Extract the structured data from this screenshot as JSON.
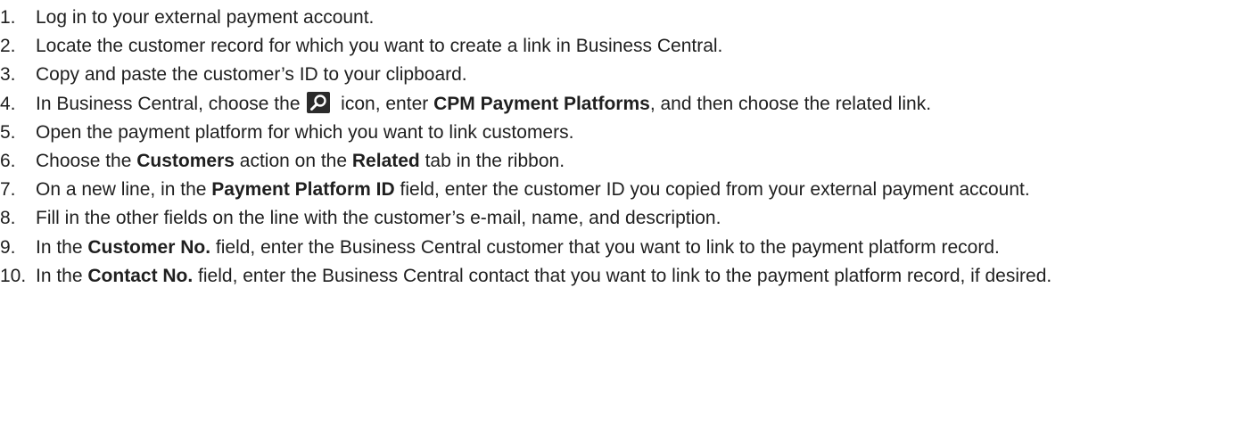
{
  "steps": [
    {
      "num": "1.",
      "parts": [
        {
          "t": "text",
          "v": "Log in to your external payment account."
        }
      ]
    },
    {
      "num": "2.",
      "parts": [
        {
          "t": "text",
          "v": "Locate the customer record for which you want to create a link in Business Central."
        }
      ]
    },
    {
      "num": "3.",
      "parts": [
        {
          "t": "text",
          "v": "Copy and paste the customer’s ID to your clipboard."
        }
      ]
    },
    {
      "num": "4.",
      "parts": [
        {
          "t": "text",
          "v": "In Business Central, choose the "
        },
        {
          "t": "icon",
          "v": "search-icon"
        },
        {
          "t": "text",
          "v": " icon, enter "
        },
        {
          "t": "bold",
          "v": "CPM Payment Platforms"
        },
        {
          "t": "text",
          "v": ", and then choose the related link."
        }
      ]
    },
    {
      "num": "5.",
      "parts": [
        {
          "t": "text",
          "v": "Open the payment platform for which you want to link customers."
        }
      ]
    },
    {
      "num": "6.",
      "parts": [
        {
          "t": "text",
          "v": "Choose the "
        },
        {
          "t": "bold",
          "v": "Customers"
        },
        {
          "t": "text",
          "v": " action on the "
        },
        {
          "t": "bold",
          "v": "Related"
        },
        {
          "t": "text",
          "v": " tab in the ribbon."
        }
      ]
    },
    {
      "num": "7.",
      "parts": [
        {
          "t": "text",
          "v": "On a new line, in the "
        },
        {
          "t": "bold",
          "v": "Payment Platform ID"
        },
        {
          "t": "text",
          "v": " field, enter the customer ID you copied from your external payment account."
        }
      ]
    },
    {
      "num": "8.",
      "parts": [
        {
          "t": "text",
          "v": "Fill in the other fields on the line with the customer’s e-mail, name, and description."
        }
      ]
    },
    {
      "num": "9.",
      "parts": [
        {
          "t": "text",
          "v": "In the "
        },
        {
          "t": "bold",
          "v": "Customer No."
        },
        {
          "t": "text",
          "v": " field, enter the Business Central customer that you want to link to the payment platform record."
        }
      ]
    },
    {
      "num": "10.",
      "parts": [
        {
          "t": "text",
          "v": "In the "
        },
        {
          "t": "bold",
          "v": "Contact No."
        },
        {
          "t": "text",
          "v": " field, enter the Business Central contact that you want to link to the payment platform record, if desired."
        }
      ]
    }
  ]
}
